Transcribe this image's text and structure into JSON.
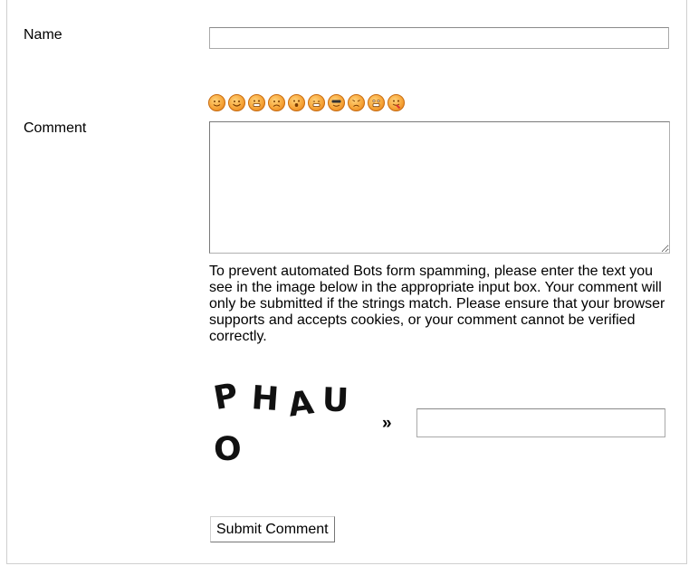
{
  "form": {
    "name_label": "Name",
    "name_value": "",
    "comment_label": "Comment",
    "comment_value": "",
    "smileys": [
      "smile-icon",
      "happy-icon",
      "grin-icon",
      "sad-icon",
      "surprised-icon",
      "wink-icon",
      "cool-icon",
      "angry-icon",
      "shock-icon",
      "tongue-icon"
    ],
    "spam_notice": "To prevent automated Bots form spamming, please enter the text you see in the image below in the appropriate input box. Your comment will only be submitted if the strings match. Please ensure that your browser supports and accepts cookies, or your comment cannot be verified correctly.",
    "captcha_text": [
      "P",
      "H",
      "A",
      "U",
      "O"
    ],
    "captcha_arrow": "»",
    "captcha_value": "",
    "submit_label": "Submit Comment"
  },
  "colors": {
    "smiley_fill": "#f7a63a",
    "smiley_border": "#c76a10",
    "border": "#a9a9a9"
  }
}
